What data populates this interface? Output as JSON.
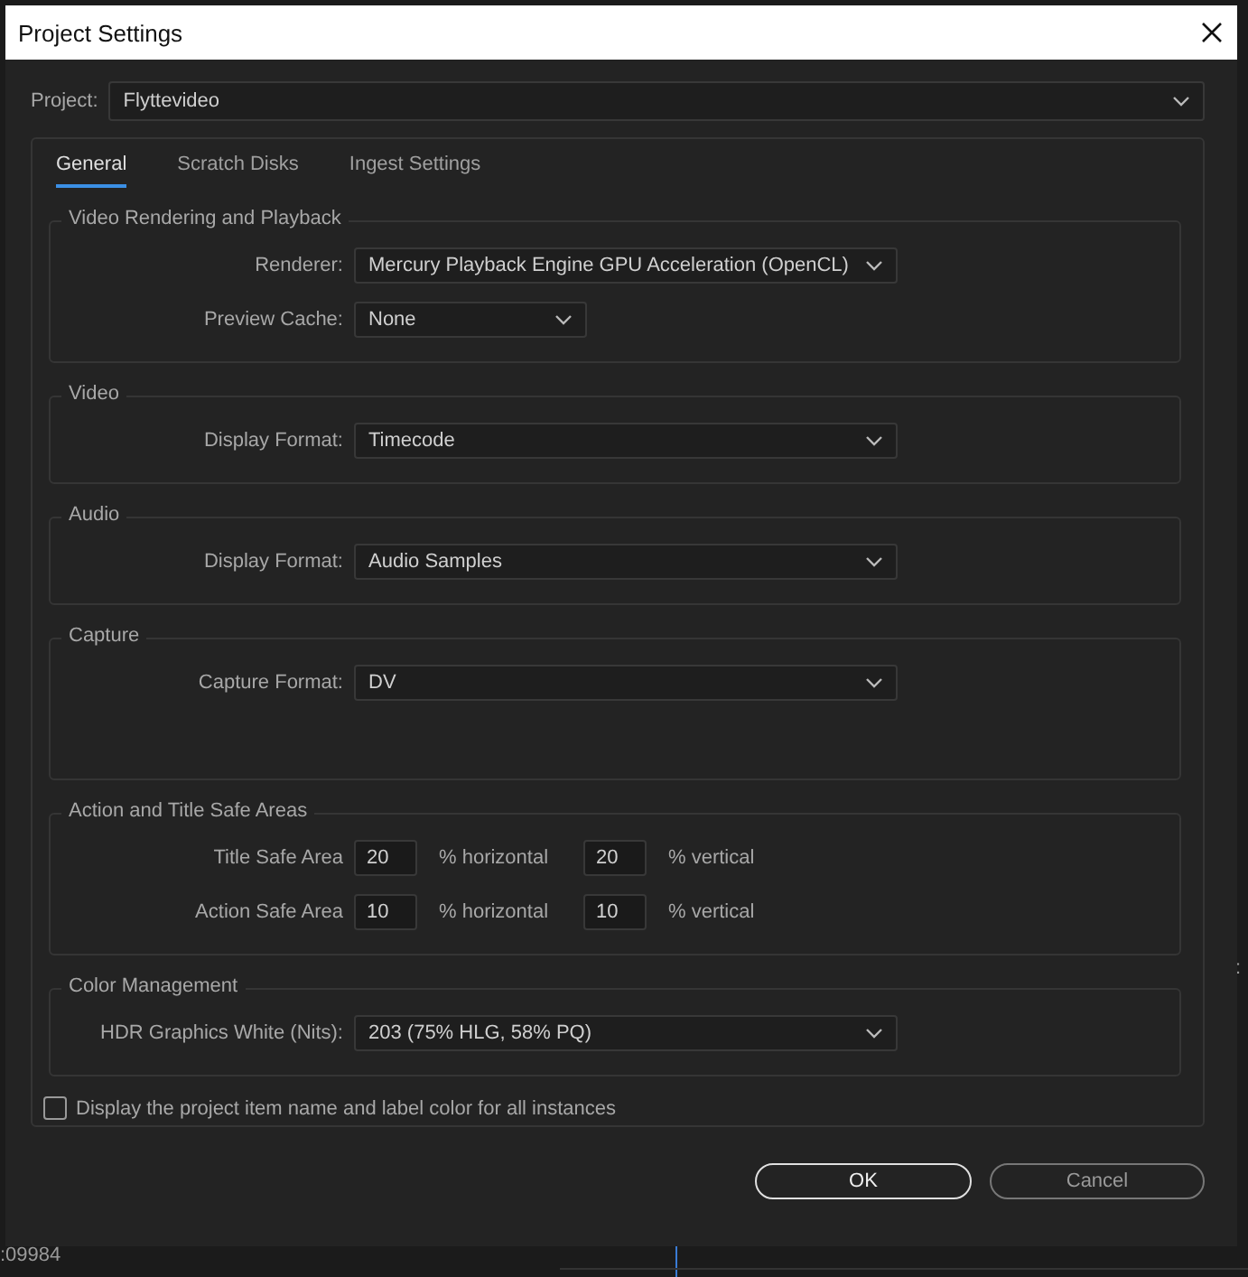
{
  "window": {
    "title": "Project Settings"
  },
  "project": {
    "label": "Project:",
    "value": "Flyttevideo"
  },
  "tabs": [
    {
      "label": "General",
      "selected": true
    },
    {
      "label": "Scratch Disks",
      "selected": false
    },
    {
      "label": "Ingest Settings",
      "selected": false
    }
  ],
  "groups": [
    {
      "title": "Video Rendering and Playback",
      "rows": [
        {
          "kind": "dropdown",
          "label": "Renderer:",
          "value": "Mercury Playback Engine GPU Acceleration (OpenCL)"
        },
        {
          "kind": "dropdown",
          "label": "Preview Cache:",
          "value": "None"
        }
      ]
    },
    {
      "title": "Video",
      "rows": [
        {
          "kind": "dropdown",
          "label": "Display Format:",
          "value": "Timecode"
        }
      ]
    },
    {
      "title": "Audio",
      "rows": [
        {
          "kind": "dropdown",
          "label": "Display Format:",
          "value": "Audio Samples"
        }
      ]
    },
    {
      "title": "Capture",
      "rows": [
        {
          "kind": "dropdown",
          "label": "Capture Format:",
          "value": "DV"
        }
      ]
    },
    {
      "title": "Action and Title Safe Areas",
      "rows": [
        {
          "kind": "safe_area",
          "label": "Title Safe Area",
          "horizontal": "20",
          "horizontal_label": "% horizontal",
          "vertical": "20",
          "vertical_label": "% vertical"
        },
        {
          "kind": "safe_area",
          "label": "Action Safe Area",
          "horizontal": "10",
          "horizontal_label": "% horizontal",
          "vertical": "10",
          "vertical_label": "% vertical"
        }
      ]
    },
    {
      "title": "Color Management",
      "rows": [
        {
          "kind": "dropdown",
          "label": "HDR Graphics White (Nits):",
          "value": "203 (75% HLG, 58% PQ)"
        }
      ]
    }
  ],
  "checkbox": {
    "label": "Display the project item name and label color for all instances",
    "checked": false
  },
  "buttons": [
    {
      "label": "OK",
      "kind": "primary"
    },
    {
      "label": "Cancel",
      "kind": "secondary"
    }
  ],
  "background": {
    "timecode": ":09984",
    "text_2": ":"
  }
}
